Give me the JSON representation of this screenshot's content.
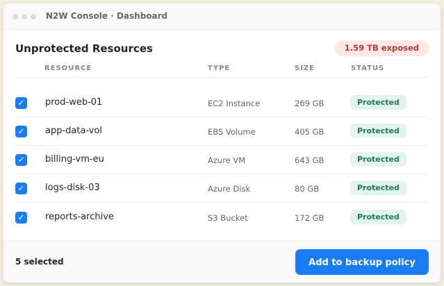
{
  "window": {
    "title": "N2W Console · Dashboard"
  },
  "panel": {
    "title": "Unprotected Resources",
    "badge": "1.59 TB exposed",
    "columns": {
      "resource": "RESOURCE",
      "type": "TYPE",
      "size": "SIZE",
      "status": "STATUS"
    },
    "rows": [
      {
        "checked": true,
        "name": "prod-web-01",
        "type": "EC2 Instance",
        "size": "269 GB",
        "status": "Protected"
      },
      {
        "checked": true,
        "name": "app-data-vol",
        "type": "EBS Volume",
        "size": "405 GB",
        "status": "Protected"
      },
      {
        "checked": true,
        "name": "billing-vm-eu",
        "type": "Azure VM",
        "size": "643 GB",
        "status": "Protected"
      },
      {
        "checked": true,
        "name": "logs-disk-03",
        "type": "Azure Disk",
        "size": "80 GB",
        "status": "Protected"
      },
      {
        "checked": true,
        "name": "reports-archive",
        "type": "S3 Bucket",
        "size": "172 GB",
        "status": "Protected"
      }
    ]
  },
  "footer": {
    "selected": "5 selected",
    "action": "Add to backup policy"
  },
  "colors": {
    "accent": "#1a7cf2",
    "danger": "#c0392b",
    "success": "#1f7a5a"
  },
  "icons": {
    "checkbox": "check-icon"
  }
}
